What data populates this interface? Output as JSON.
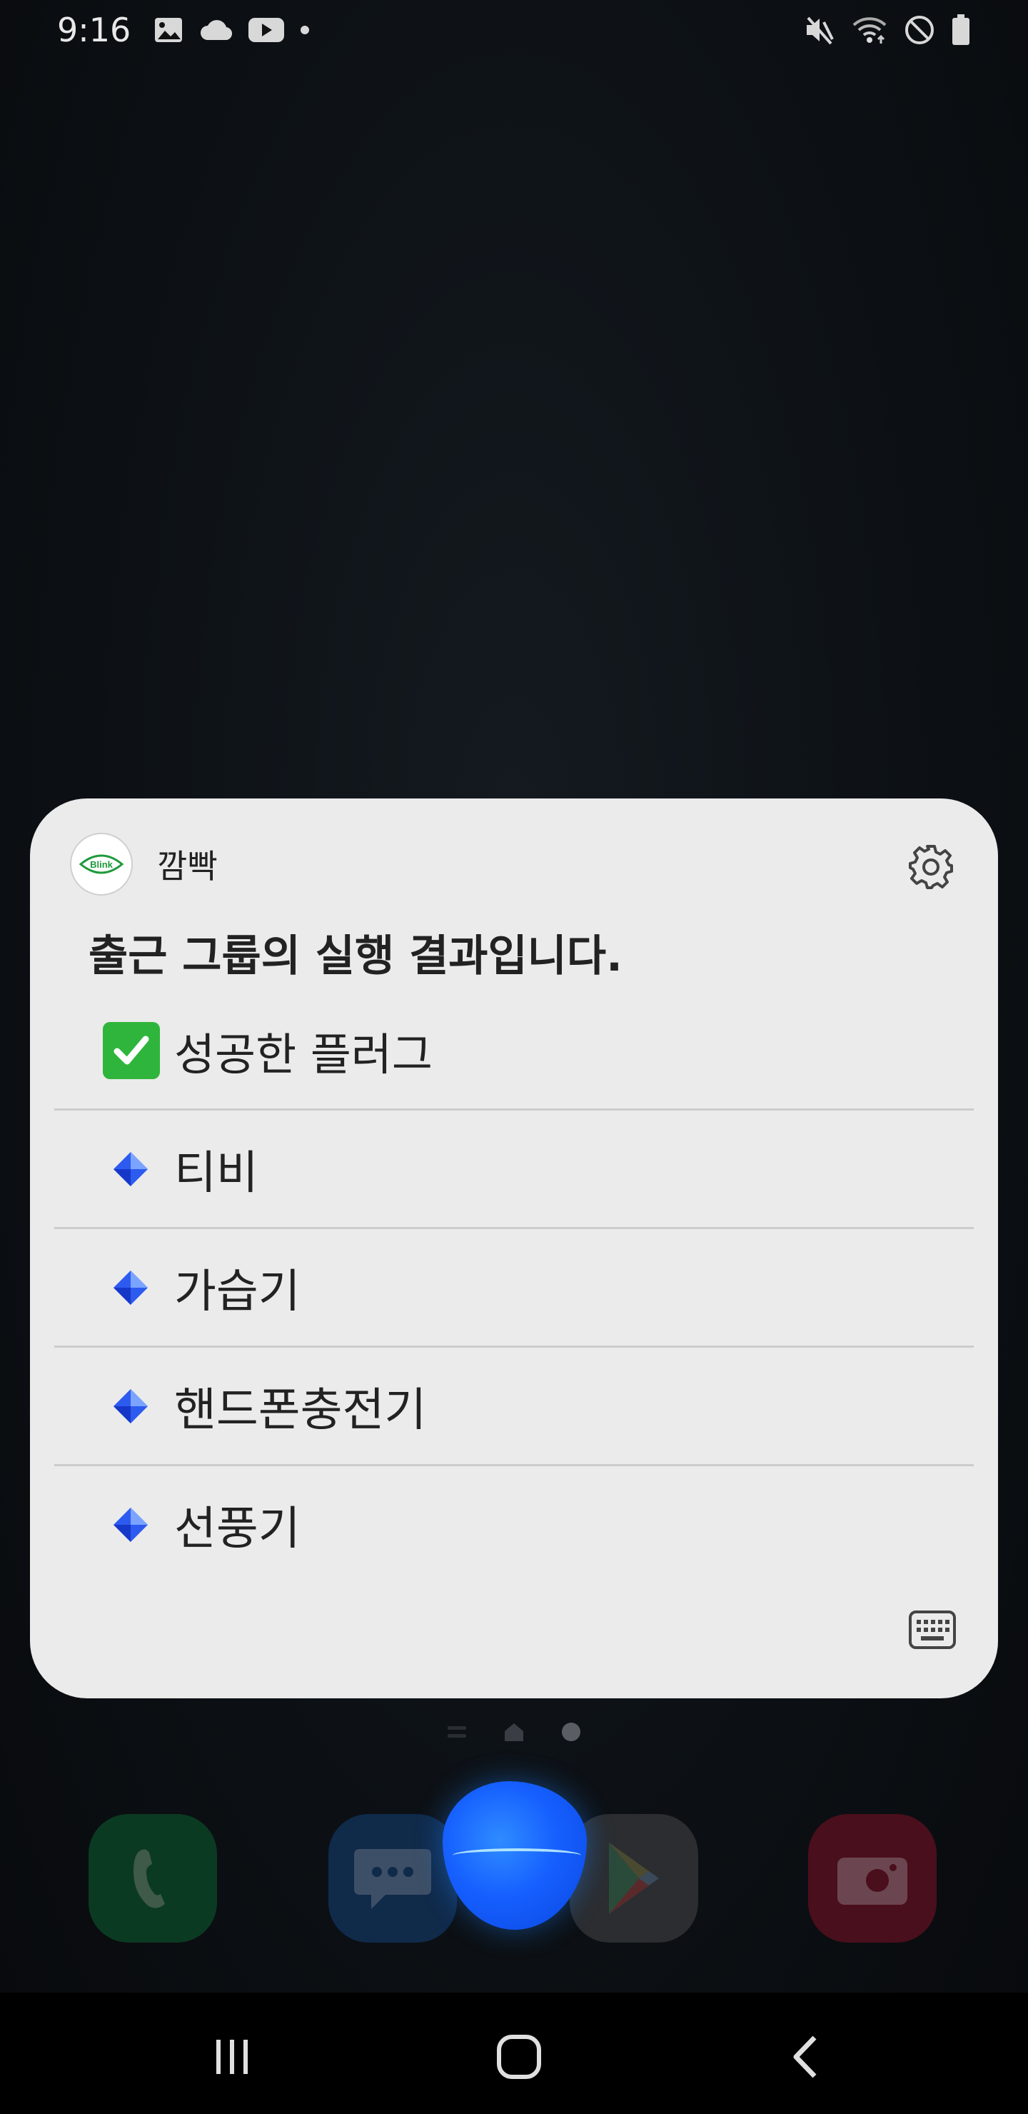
{
  "status_bar": {
    "time": "9:16",
    "left_icons": [
      "image-icon",
      "cloud-icon",
      "youtube-icon",
      "notification-dot"
    ],
    "right_icons": [
      "mute-icon",
      "wifi-icon",
      "do-not-disturb-icon",
      "battery-icon"
    ]
  },
  "card": {
    "app_name": "깜빡",
    "logo_text": "Blink",
    "headline": "출근 그룹의 실행 결과입니다.",
    "success_label": "성공한 플러그",
    "items": [
      {
        "label": "티비"
      },
      {
        "label": "가습기"
      },
      {
        "label": "핸드폰충전기"
      },
      {
        "label": "선풍기"
      }
    ],
    "icons": {
      "settings": "settings-gear-icon",
      "keyboard": "keyboard-icon",
      "success": "check-mark-icon",
      "bullet": "blue-diamond-icon"
    }
  },
  "dock": {
    "apps": [
      "phone",
      "messages",
      "play-store",
      "camera"
    ]
  },
  "nav_bar": {
    "buttons": [
      "recent-apps",
      "home",
      "back"
    ]
  },
  "colors": {
    "background": "#0c1014",
    "card": "#ebebeb",
    "check": "#2fb53b",
    "diamond": "#2d5bf0",
    "assistant": "#1660ff"
  }
}
